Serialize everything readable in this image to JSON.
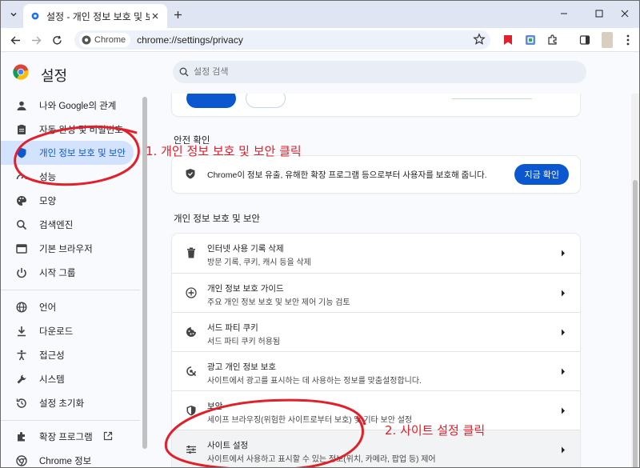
{
  "tab": {
    "title": "설정 - 개인 정보 보호 및 보안"
  },
  "omnibox": {
    "chip_label": "Chrome",
    "url": "chrome://settings/privacy"
  },
  "header": {
    "title": "설정",
    "search_placeholder": "설정 검색"
  },
  "sidebar": {
    "items": [
      {
        "label": "나와 Google의 관계",
        "icon": "person-icon"
      },
      {
        "label": "자동 완성 및 비밀번호",
        "icon": "clipboard-icon"
      },
      {
        "label": "개인 정보 보호 및 보안",
        "icon": "shield-icon",
        "active": true
      },
      {
        "label": "성능",
        "icon": "speedometer-icon"
      },
      {
        "label": "모양",
        "icon": "palette-icon"
      },
      {
        "label": "검색엔진",
        "icon": "search-icon"
      },
      {
        "label": "기본 브라우저",
        "icon": "browser-icon"
      },
      {
        "label": "시작 그룹",
        "icon": "power-icon"
      },
      {
        "label": "언어",
        "icon": "globe-icon"
      },
      {
        "label": "다운로드",
        "icon": "download-icon"
      },
      {
        "label": "접근성",
        "icon": "accessibility-icon"
      },
      {
        "label": "시스템",
        "icon": "wrench-icon"
      },
      {
        "label": "설정 초기화",
        "icon": "history-icon"
      },
      {
        "label": "확장 프로그램",
        "icon": "puzzle-icon"
      },
      {
        "label": "Chrome 정보",
        "icon": "chrome-icon"
      }
    ]
  },
  "safety": {
    "section_title": "안전 확인",
    "text": "Chrome이 정보 유출, 유해한 확장 프로그램 등으로부터 사용자를 보호해 줍니다.",
    "button": "지금 확인"
  },
  "privacy": {
    "section_title": "개인 정보 보호 및 보안",
    "rows": [
      {
        "title": "인터넷 사용 기록 삭제",
        "subtitle": "방문 기록, 쿠키, 캐시 등을 삭제",
        "icon": "trash-icon"
      },
      {
        "title": "개인 정보 보호 가이드",
        "subtitle": "주요 개인 정보 보호 및 보안 제어 기능 검토",
        "icon": "compass-plus-icon"
      },
      {
        "title": "서드 파티 쿠키",
        "subtitle": "서드 파티 쿠키 허용됨",
        "icon": "cookie-icon"
      },
      {
        "title": "광고 개인 정보 보호",
        "subtitle": "사이트에서 광고를 표시하는 데 사용하는 정보를 맞춤설정합니다.",
        "icon": "ad-privacy-icon"
      },
      {
        "title": "보안",
        "subtitle": "세이프 브라우징(위험한 사이트로부터 보호) 및 기타 보안 설정",
        "icon": "shield-icon"
      },
      {
        "title": "사이트 설정",
        "subtitle": "사이트에서 사용하고 표시할 수 있는 정보(위치, 카메라, 팝업 등) 제어",
        "icon": "sliders-icon"
      }
    ]
  },
  "annotations": {
    "step1": "1. 개인 정보 보호 및 보안 클릭",
    "step2": "2. 사이트 설정 클릭"
  },
  "colors": {
    "accent": "#0b57d0",
    "annotation": "#e0202a",
    "active_bg": "#d3e3fd"
  }
}
